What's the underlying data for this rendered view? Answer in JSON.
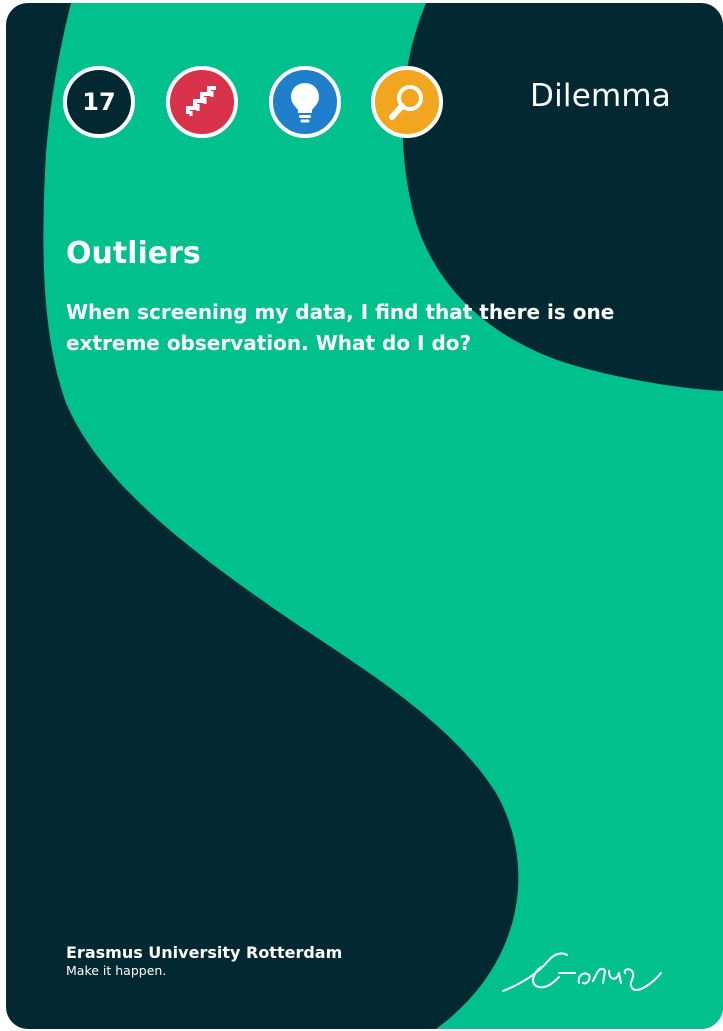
{
  "card": {
    "number": "17",
    "type": "Dilemma",
    "title": "Outliers",
    "question": "When screening my data, I find that there is one extreme observation. What do I do?"
  },
  "badges": [
    {
      "name": "number",
      "icon": "number-badge"
    },
    {
      "name": "steps",
      "icon": "stairs-icon",
      "color": "#d9334b"
    },
    {
      "name": "idea",
      "icon": "lightbulb-icon",
      "color": "#1f7fcc"
    },
    {
      "name": "search",
      "icon": "magnifier-icon",
      "color": "#f2a51f"
    }
  ],
  "brand": {
    "name": "Erasmus University Rotterdam",
    "tagline": "Make it happen.",
    "signature_text": "Erasmus"
  },
  "colors": {
    "background": "#022832",
    "accent_green": "#00c08d",
    "text": "#ffffff"
  }
}
